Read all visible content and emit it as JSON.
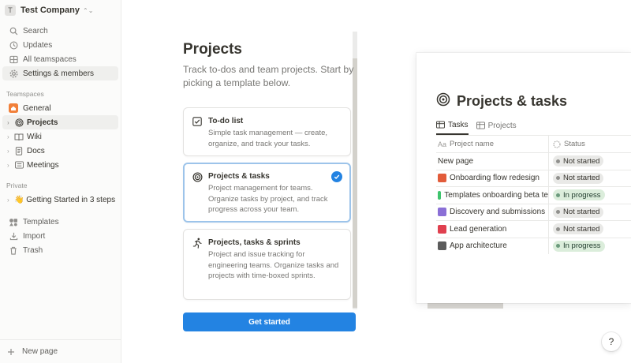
{
  "workspace": {
    "avatar_letter": "T",
    "name": "Test Company"
  },
  "sidebar": {
    "top_items": [
      {
        "label": "Search",
        "icon": "search-icon"
      },
      {
        "label": "Updates",
        "icon": "clock-icon"
      },
      {
        "label": "All teamspaces",
        "icon": "grid-icon"
      },
      {
        "label": "Settings & members",
        "icon": "gear-icon"
      }
    ],
    "teamspaces_heading": "Teamspaces",
    "teamspace_name": "General",
    "tree": [
      {
        "label": "Projects",
        "icon": "target-icon"
      },
      {
        "label": "Wiki",
        "icon": "book-icon"
      },
      {
        "label": "Docs",
        "icon": "doc-icon"
      },
      {
        "label": "Meetings",
        "icon": "list-icon"
      }
    ],
    "private_heading": "Private",
    "private_items": [
      {
        "label": "👋 Getting Started in 3 steps"
      }
    ],
    "bottom_items": [
      {
        "label": "Templates",
        "icon": "shapes-icon"
      },
      {
        "label": "Import",
        "icon": "download-icon"
      },
      {
        "label": "Trash",
        "icon": "trash-icon"
      }
    ],
    "new_page": "New page"
  },
  "picker": {
    "title": "Projects",
    "description": "Track to-dos and team projects. Start by picking a template below.",
    "options": [
      {
        "title": "To-do list",
        "description": "Simple task management — create, organize, and track your tasks.",
        "icon": "checkbox-icon",
        "selected": false
      },
      {
        "title": "Projects & tasks",
        "description": "Project management for teams. Organize tasks by project, and track progress across your team.",
        "icon": "target-icon",
        "selected": true
      },
      {
        "title": "Projects, tasks & sprints",
        "description": "Project and issue tracking for engineering teams. Organize tasks and projects with time-boxed sprints.",
        "icon": "runner-icon",
        "selected": false
      }
    ],
    "cta": "Get started"
  },
  "preview": {
    "title": "Projects & tasks",
    "tabs": [
      {
        "label": "Tasks",
        "active": true
      },
      {
        "label": "Projects",
        "active": false
      }
    ],
    "columns": {
      "name": "Project name",
      "status": "Status",
      "name_prefix": "Aa"
    },
    "rows": [
      {
        "name": "New page",
        "emoji": "",
        "status": "Not started"
      },
      {
        "name": "Onboarding flow redesign",
        "emoji": "#e25c3a",
        "status": "Not started"
      },
      {
        "name": "Templates onboarding beta te",
        "emoji": "#3ec46d",
        "status": "In progress"
      },
      {
        "name": "Discovery and submissions",
        "emoji": "#8a6fd6",
        "status": "Not started"
      },
      {
        "name": "Lead generation",
        "emoji": "#e0404f",
        "status": "Not started"
      },
      {
        "name": "App architecture",
        "emoji": "#5b5b5b",
        "status": "In progress"
      }
    ],
    "status_styles": {
      "Not started": {
        "bg": "#e9e9e7",
        "fg": "#37352f",
        "dot": "#91918e"
      },
      "In progress": {
        "bg": "#dbeddb",
        "fg": "#1c3829",
        "dot": "#6c9b7d"
      }
    }
  },
  "help": "?"
}
